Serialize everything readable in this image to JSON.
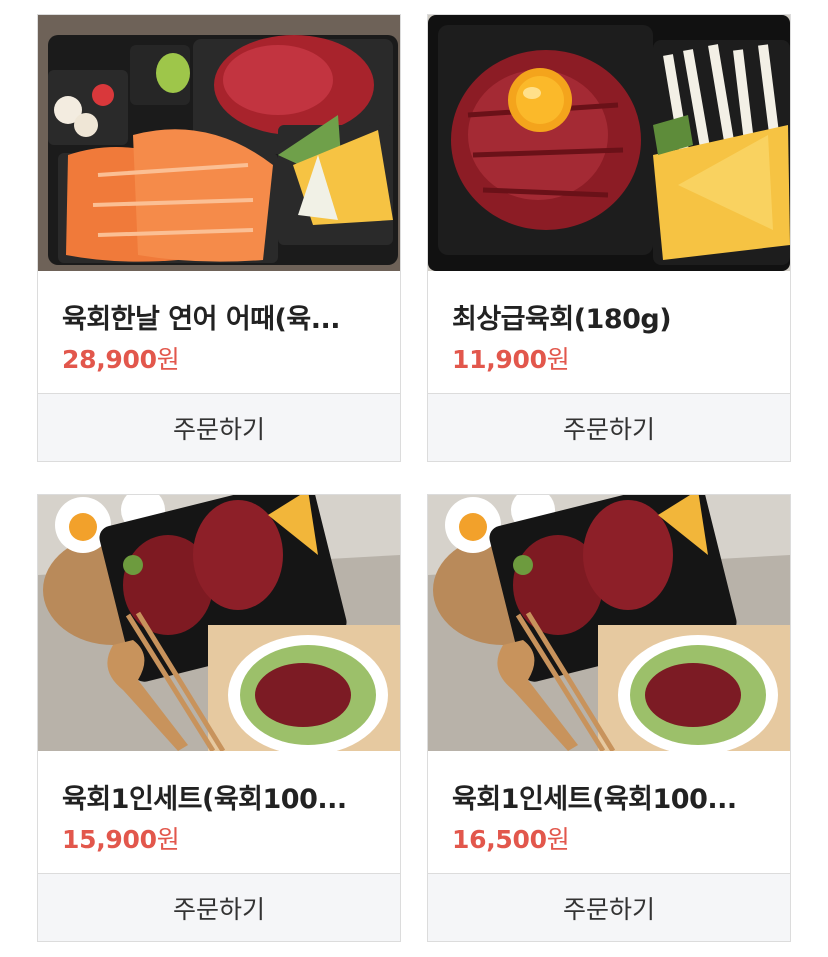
{
  "products": [
    {
      "name": "육회한날 연어 어때(육...",
      "price": "28,900",
      "price_unit": "원",
      "order_label": "주문하기",
      "image": "salmon-and-yukhoe-box-photo"
    },
    {
      "name": "최상급육회(180g)",
      "price": "11,900",
      "price_unit": "원",
      "order_label": "주문하기",
      "image": "yukhoe-with-egg-yolk-photo"
    },
    {
      "name": "육회1인세트(육회100...",
      "price": "15,900",
      "price_unit": "원",
      "order_label": "주문하기",
      "image": "yukhoe-single-set-photo"
    },
    {
      "name": "육회1인세트(육회100...",
      "price": "16,500",
      "price_unit": "원",
      "order_label": "주문하기",
      "image": "yukhoe-single-set-photo"
    }
  ],
  "colors": {
    "price": "#e2574c",
    "button_bg": "#f5f6f8",
    "border": "#dcdcdc"
  }
}
